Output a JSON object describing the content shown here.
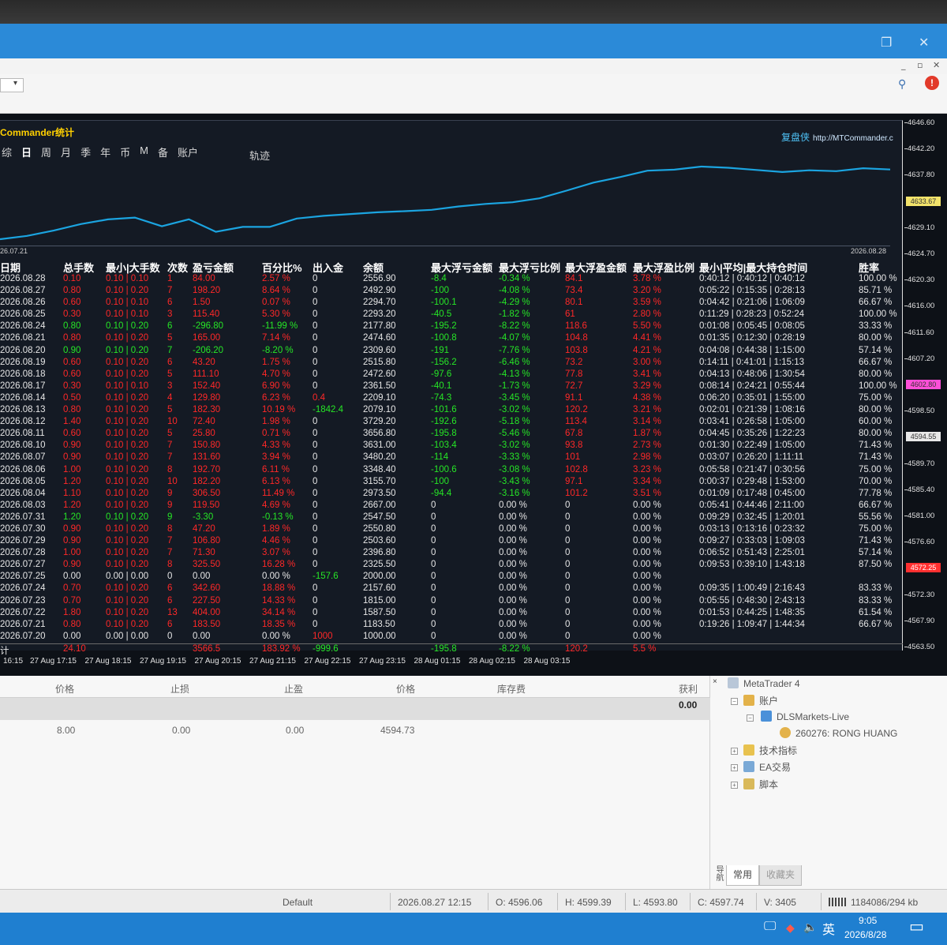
{
  "window": {
    "restore_icon": "❐",
    "close_icon": "✕",
    "menu_min": "_",
    "menu_restore": "▫",
    "menu_close": "✕"
  },
  "toolbar": {
    "dropdown_icon": "▾",
    "search_icon": "⚲",
    "alert_badge": "!"
  },
  "chart": {
    "title": "Commander统计",
    "brand": "复盘侠",
    "brand_url": "http://MTCommander.c",
    "tabs": [
      "综",
      "日",
      "周",
      "月",
      "季",
      "年",
      "币",
      "M",
      "备",
      "账户"
    ],
    "active_tab": "日",
    "track_label": "轨迹",
    "date_start": "26.07.21",
    "date_end": "2026.08.28",
    "curve_color": "#1ba4e0",
    "curve_points": [
      2000,
      2079,
      2209,
      2361,
      2472,
      2515,
      2309,
      2474,
      2177,
      2293,
      2294,
      2492,
      2556,
      2600,
      2640,
      2667,
      2700,
      2780,
      2840,
      2880,
      2973,
      3155,
      3348,
      3480,
      3631,
      3656,
      3729,
      3700,
      3650,
      3600,
      3640,
      3620,
      3690,
      3660
    ]
  },
  "stats": {
    "headers": [
      "日期",
      "总手数",
      "最小|大手数",
      "次数",
      "盈亏金额",
      "百分比%",
      "出入金",
      "余额",
      "最大浮亏金额",
      "最大浮亏比例",
      "最大浮盈金额",
      "最大浮盈比例",
      "最小|平均|最大持仓时间",
      "胜率"
    ],
    "rows": [
      [
        "2026.08.28",
        "0.10",
        "0.10 | 0.10",
        "1",
        "84.00",
        "2.57 %",
        "0",
        "2556.90",
        "-8.4",
        "-0.34 %",
        "84.1",
        "3.78 %",
        "0:40:12 | 0:40:12 | 0:40:12",
        "100.00 %",
        "r"
      ],
      [
        "2026.08.27",
        "0.80",
        "0.10 | 0.20",
        "7",
        "198.20",
        "8.64 %",
        "0",
        "2492.90",
        "-100",
        "-4.08 %",
        "73.4",
        "3.20 %",
        "0:05:22 | 0:15:35 | 0:28:13",
        "85.71 %",
        "r"
      ],
      [
        "2026.08.26",
        "0.60",
        "0.10 | 0.10",
        "6",
        "1.50",
        "0.07 %",
        "0",
        "2294.70",
        "-100.1",
        "-4.29 %",
        "80.1",
        "3.59 %",
        "0:04:42 | 0:21:06 | 1:06:09",
        "66.67 %",
        "r"
      ],
      [
        "2026.08.25",
        "0.30",
        "0.10 | 0.10",
        "3",
        "115.40",
        "5.30 %",
        "0",
        "2293.20",
        "-40.5",
        "-1.82 %",
        "61",
        "2.80 %",
        "0:11:29 | 0:28:23 | 0:52:24",
        "100.00 %",
        "r"
      ],
      [
        "2026.08.24",
        "0.80",
        "0.10 | 0.20",
        "6",
        "-296.80",
        "-11.99 %",
        "0",
        "2177.80",
        "-195.2",
        "-8.22 %",
        "118.6",
        "5.50 %",
        "0:01:08 | 0:05:45 | 0:08:05",
        "33.33 %",
        "g"
      ],
      [
        "2026.08.21",
        "0.80",
        "0.10 | 0.20",
        "5",
        "165.00",
        "7.14 %",
        "0",
        "2474.60",
        "-100.8",
        "-4.07 %",
        "104.8",
        "4.41 %",
        "0:01:35 | 0:12:30 | 0:28:19",
        "80.00 %",
        "r"
      ],
      [
        "2026.08.20",
        "0.90",
        "0.10 | 0.20",
        "7",
        "-206.20",
        "-8.20 %",
        "0",
        "2309.60",
        "-191",
        "-7.76 %",
        "103.8",
        "4.21 %",
        "0:04:08 | 0:44:38 | 1:15:00",
        "57.14 %",
        "g"
      ],
      [
        "2026.08.19",
        "0.60",
        "0.10 | 0.20",
        "6",
        "43.20",
        "1.75 %",
        "0",
        "2515.80",
        "-156.2",
        "-6.46 %",
        "73.2",
        "3.00 %",
        "0:14:11 | 0:41:01 | 1:15:13",
        "66.67 %",
        "r"
      ],
      [
        "2026.08.18",
        "0.60",
        "0.10 | 0.20",
        "5",
        "111.10",
        "4.70 %",
        "0",
        "2472.60",
        "-97.6",
        "-4.13 %",
        "77.8",
        "3.41 %",
        "0:04:13 | 0:48:06 | 1:30:54",
        "80.00 %",
        "r"
      ],
      [
        "2026.08.17",
        "0.30",
        "0.10 | 0.10",
        "3",
        "152.40",
        "6.90 %",
        "0",
        "2361.50",
        "-40.1",
        "-1.73 %",
        "72.7",
        "3.29 %",
        "0:08:14 | 0:24:21 | 0:55:44",
        "100.00 %",
        "r"
      ],
      [
        "2026.08.14",
        "0.50",
        "0.10 | 0.20",
        "4",
        "129.80",
        "6.23 %",
        "0.4",
        "2209.10",
        "-74.3",
        "-3.45 %",
        "91.1",
        "4.38 %",
        "0:06:20 | 0:35:01 | 1:55:00",
        "75.00 %",
        "r"
      ],
      [
        "2026.08.13",
        "0.80",
        "0.10 | 0.20",
        "5",
        "182.30",
        "10.19 %",
        "-1842.4",
        "2079.10",
        "-101.6",
        "-3.02 %",
        "120.2",
        "3.21 %",
        "0:02:01 | 0:21:39 | 1:08:16",
        "80.00 %",
        "r"
      ],
      [
        "2026.08.12",
        "1.40",
        "0.10 | 0.20",
        "10",
        "72.40",
        "1.98 %",
        "0",
        "3729.20",
        "-192.6",
        "-5.18 %",
        "113.4",
        "3.14 %",
        "0:03:41 | 0:26:58 | 1:05:00",
        "60.00 %",
        "r"
      ],
      [
        "2026.08.11",
        "0.60",
        "0.10 | 0.20",
        "5",
        "25.80",
        "0.71 %",
        "0",
        "3656.80",
        "-195.8",
        "-5.46 %",
        "67.8",
        "1.87 %",
        "0:04:45 | 0:35:26 | 1:22:23",
        "80.00 %",
        "r"
      ],
      [
        "2026.08.10",
        "0.90",
        "0.10 | 0.20",
        "7",
        "150.80",
        "4.33 %",
        "0",
        "3631.00",
        "-103.4",
        "-3.02 %",
        "93.8",
        "2.73 %",
        "0:01:30 | 0:22:49 | 1:05:00",
        "71.43 %",
        "r"
      ],
      [
        "2026.08.07",
        "0.90",
        "0.10 | 0.20",
        "7",
        "131.60",
        "3.94 %",
        "0",
        "3480.20",
        "-114",
        "-3.33 %",
        "101",
        "2.98 %",
        "0:03:07 | 0:26:20 | 1:11:11",
        "71.43 %",
        "r"
      ],
      [
        "2026.08.06",
        "1.00",
        "0.10 | 0.20",
        "8",
        "192.70",
        "6.11 %",
        "0",
        "3348.40",
        "-100.6",
        "-3.08 %",
        "102.8",
        "3.23 %",
        "0:05:58 | 0:21:47 | 0:30:56",
        "75.00 %",
        "r"
      ],
      [
        "2026.08.05",
        "1.20",
        "0.10 | 0.20",
        "10",
        "182.20",
        "6.13 %",
        "0",
        "3155.70",
        "-100",
        "-3.43 %",
        "97.1",
        "3.34 %",
        "0:00:37 | 0:29:48 | 1:53:00",
        "70.00 %",
        "r"
      ],
      [
        "2026.08.04",
        "1.10",
        "0.10 | 0.20",
        "9",
        "306.50",
        "11.49 %",
        "0",
        "2973.50",
        "-94.4",
        "-3.16 %",
        "101.2",
        "3.51 %",
        "0:01:09 | 0:17:48 | 0:45:00",
        "77.78 %",
        "r"
      ],
      [
        "2026.08.03",
        "1.20",
        "0.10 | 0.20",
        "9",
        "119.50",
        "4.69 %",
        "0",
        "2667.00",
        "0",
        "0.00 %",
        "0",
        "0.00 %",
        "0:05:41 | 0:44:46 | 2:11:00",
        "66.67 %",
        "r"
      ],
      [
        "2026.07.31",
        "1.20",
        "0.10 | 0.20",
        "9",
        "-3.30",
        "-0.13 %",
        "0",
        "2547.50",
        "0",
        "0.00 %",
        "0",
        "0.00 %",
        "0:09:29 | 0:32:45 | 1:20:01",
        "55.56 %",
        "g"
      ],
      [
        "2026.07.30",
        "0.90",
        "0.10 | 0.20",
        "8",
        "47.20",
        "1.89 %",
        "0",
        "2550.80",
        "0",
        "0.00 %",
        "0",
        "0.00 %",
        "0:03:13 | 0:13:16 | 0:23:32",
        "75.00 %",
        "r"
      ],
      [
        "2026.07.29",
        "0.90",
        "0.10 | 0.20",
        "7",
        "106.80",
        "4.46 %",
        "0",
        "2503.60",
        "0",
        "0.00 %",
        "0",
        "0.00 %",
        "0:09:27 | 0:33:03 | 1:09:03",
        "71.43 %",
        "r"
      ],
      [
        "2026.07.28",
        "1.00",
        "0.10 | 0.20",
        "7",
        "71.30",
        "3.07 %",
        "0",
        "2396.80",
        "0",
        "0.00 %",
        "0",
        "0.00 %",
        "0:06:52 | 0:51:43 | 2:25:01",
        "57.14 %",
        "r"
      ],
      [
        "2026.07.27",
        "0.90",
        "0.10 | 0.20",
        "8",
        "325.50",
        "16.28 %",
        "0",
        "2325.50",
        "0",
        "0.00 %",
        "0",
        "0.00 %",
        "0:09:53 | 0:39:10 | 1:43:18",
        "87.50 %",
        "r"
      ],
      [
        "2026.07.25",
        "0.00",
        "0.00 | 0.00",
        "0",
        "0.00",
        "0.00 %",
        "-157.6",
        "2000.00",
        "0",
        "0.00 %",
        "0",
        "0.00 %",
        "",
        "",
        "w"
      ],
      [
        "2026.07.24",
        "0.70",
        "0.10 | 0.20",
        "6",
        "342.60",
        "18.88 %",
        "0",
        "2157.60",
        "0",
        "0.00 %",
        "0",
        "0.00 %",
        "0:09:35 | 1:00:49 | 2:16:43",
        "83.33 %",
        "r"
      ],
      [
        "2026.07.23",
        "0.70",
        "0.10 | 0.20",
        "6",
        "227.50",
        "14.33 %",
        "0",
        "1815.00",
        "0",
        "0.00 %",
        "0",
        "0.00 %",
        "0:05:55 | 0:48:30 | 2:43:13",
        "83.33 %",
        "r"
      ],
      [
        "2026.07.22",
        "1.80",
        "0.10 | 0.20",
        "13",
        "404.00",
        "34.14 %",
        "0",
        "1587.50",
        "0",
        "0.00 %",
        "0",
        "0.00 %",
        "0:01:53 | 0:44:25 | 1:48:35",
        "61.54 %",
        "r"
      ],
      [
        "2026.07.21",
        "0.80",
        "0.10 | 0.20",
        "6",
        "183.50",
        "18.35 %",
        "0",
        "1183.50",
        "0",
        "0.00 %",
        "0",
        "0.00 %",
        "0:19:26 | 1:09:47 | 1:44:34",
        "66.67 %",
        "r"
      ],
      [
        "2026.07.20",
        "0.00",
        "0.00 | 0.00",
        "0",
        "0.00",
        "0.00 %",
        "1000",
        "1000.00",
        "0",
        "0.00 %",
        "0",
        "0.00 %",
        "",
        "",
        "w"
      ]
    ],
    "total": {
      "label": "计",
      "lots": "24.10",
      "pnl": "3566.5",
      "pct": "183.92 %",
      "io": "-999.6",
      "ddamt": "-195.8",
      "ddpct": "-8.22 %",
      "pfamt": "120.2",
      "pfpct": "5.5 %"
    }
  },
  "price_axis": {
    "ticks": [
      "4646.60",
      "4642.20",
      "4637.80",
      "4633.67",
      "4629.10",
      "4624.70",
      "4620.30",
      "4616.00",
      "4611.60",
      "4607.20",
      "4602.80",
      "4598.50",
      "4594.55",
      "4589.70",
      "4585.40",
      "4581.00",
      "4576.60",
      "4572.25",
      "4572.30",
      "4567.90",
      "4563.50"
    ],
    "tag_colors": {
      "4633.67": "#f2e36b",
      "4602.80": "#ff4fd8",
      "4594.55": "#e8e8e8",
      "4572.25": "#ff3030"
    }
  },
  "time_axis": [
    "16:15",
    "27 Aug 17:15",
    "27 Aug 18:15",
    "27 Aug 19:15",
    "27 Aug 20:15",
    "27 Aug 21:15",
    "27 Aug 22:15",
    "27 Aug 23:15",
    "28 Aug 01:15",
    "28 Aug 02:15",
    "28 Aug 03:15"
  ],
  "terminal": {
    "headers": [
      "价格",
      "止损",
      "止盈",
      "价格",
      "库存费",
      "获利"
    ],
    "summary_profit": "0.00",
    "row": [
      "8.00",
      "0.00",
      "0.00",
      "4594.73"
    ]
  },
  "navigator": {
    "close": "×",
    "root": "MetaTrader 4",
    "accounts": "账户",
    "server": "DLSMarkets-Live",
    "account": "260276: RONG HUANG",
    "indicators": "技术指标",
    "ea": "EA交易",
    "scripts": "脚本",
    "side_label": "导航",
    "tab_common": "常用",
    "tab_fav": "收藏夹"
  },
  "statusbar": {
    "profile": "Default",
    "datetime": "2026.08.27 12:15",
    "open": "O: 4596.06",
    "high": "H: 4599.39",
    "low": "L: 4593.80",
    "close": "C: 4597.74",
    "volume": "V: 3405",
    "traffic": "1184086/294 kb"
  },
  "taskbar": {
    "ime": "英",
    "time": "9:05",
    "date": "2026/8/28",
    "notify_icon": "▭",
    "volume_icon": "🔈",
    "network_icon": "🖵",
    "shield_icon": "◆"
  }
}
